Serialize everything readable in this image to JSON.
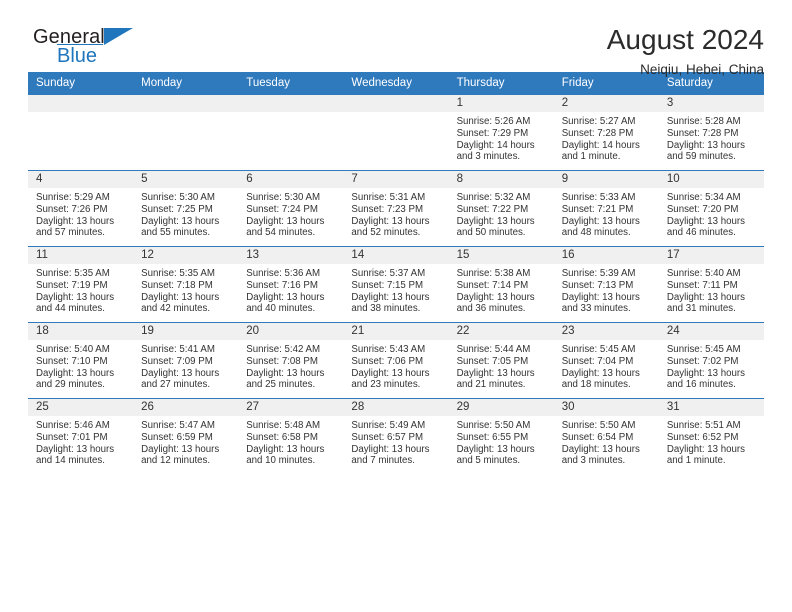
{
  "brand": {
    "name_part1": "General",
    "name_part2": "Blue",
    "logo_icon": "triangle-flag-icon",
    "accent_color": "#1f76bc"
  },
  "header": {
    "title": "August 2024",
    "subtitle": "Neiqiu, Hebei, China"
  },
  "theme": {
    "header_row_bg": "#2f79bd",
    "daynum_band_bg": "#f0f0f0",
    "grid_line": "#2f79bd",
    "text": "#333333"
  },
  "weekday_headers": [
    "Sunday",
    "Monday",
    "Tuesday",
    "Wednesday",
    "Thursday",
    "Friday",
    "Saturday"
  ],
  "labels": {
    "sunrise_prefix": "Sunrise:",
    "sunset_prefix": "Sunset:",
    "daylight_prefix": "Daylight:"
  },
  "weeks": [
    [
      {
        "day": "",
        "blank": true
      },
      {
        "day": "",
        "blank": true
      },
      {
        "day": "",
        "blank": true
      },
      {
        "day": "",
        "blank": true
      },
      {
        "day": "1",
        "sunrise": "Sunrise: 5:26 AM",
        "sunset": "Sunset: 7:29 PM",
        "daylight_line1": "Daylight: 14 hours",
        "daylight_line2": "and 3 minutes."
      },
      {
        "day": "2",
        "sunrise": "Sunrise: 5:27 AM",
        "sunset": "Sunset: 7:28 PM",
        "daylight_line1": "Daylight: 14 hours",
        "daylight_line2": "and 1 minute."
      },
      {
        "day": "3",
        "sunrise": "Sunrise: 5:28 AM",
        "sunset": "Sunset: 7:28 PM",
        "daylight_line1": "Daylight: 13 hours",
        "daylight_line2": "and 59 minutes."
      }
    ],
    [
      {
        "day": "4",
        "sunrise": "Sunrise: 5:29 AM",
        "sunset": "Sunset: 7:26 PM",
        "daylight_line1": "Daylight: 13 hours",
        "daylight_line2": "and 57 minutes."
      },
      {
        "day": "5",
        "sunrise": "Sunrise: 5:30 AM",
        "sunset": "Sunset: 7:25 PM",
        "daylight_line1": "Daylight: 13 hours",
        "daylight_line2": "and 55 minutes."
      },
      {
        "day": "6",
        "sunrise": "Sunrise: 5:30 AM",
        "sunset": "Sunset: 7:24 PM",
        "daylight_line1": "Daylight: 13 hours",
        "daylight_line2": "and 54 minutes."
      },
      {
        "day": "7",
        "sunrise": "Sunrise: 5:31 AM",
        "sunset": "Sunset: 7:23 PM",
        "daylight_line1": "Daylight: 13 hours",
        "daylight_line2": "and 52 minutes."
      },
      {
        "day": "8",
        "sunrise": "Sunrise: 5:32 AM",
        "sunset": "Sunset: 7:22 PM",
        "daylight_line1": "Daylight: 13 hours",
        "daylight_line2": "and 50 minutes."
      },
      {
        "day": "9",
        "sunrise": "Sunrise: 5:33 AM",
        "sunset": "Sunset: 7:21 PM",
        "daylight_line1": "Daylight: 13 hours",
        "daylight_line2": "and 48 minutes."
      },
      {
        "day": "10",
        "sunrise": "Sunrise: 5:34 AM",
        "sunset": "Sunset: 7:20 PM",
        "daylight_line1": "Daylight: 13 hours",
        "daylight_line2": "and 46 minutes."
      }
    ],
    [
      {
        "day": "11",
        "sunrise": "Sunrise: 5:35 AM",
        "sunset": "Sunset: 7:19 PM",
        "daylight_line1": "Daylight: 13 hours",
        "daylight_line2": "and 44 minutes."
      },
      {
        "day": "12",
        "sunrise": "Sunrise: 5:35 AM",
        "sunset": "Sunset: 7:18 PM",
        "daylight_line1": "Daylight: 13 hours",
        "daylight_line2": "and 42 minutes."
      },
      {
        "day": "13",
        "sunrise": "Sunrise: 5:36 AM",
        "sunset": "Sunset: 7:16 PM",
        "daylight_line1": "Daylight: 13 hours",
        "daylight_line2": "and 40 minutes."
      },
      {
        "day": "14",
        "sunrise": "Sunrise: 5:37 AM",
        "sunset": "Sunset: 7:15 PM",
        "daylight_line1": "Daylight: 13 hours",
        "daylight_line2": "and 38 minutes."
      },
      {
        "day": "15",
        "sunrise": "Sunrise: 5:38 AM",
        "sunset": "Sunset: 7:14 PM",
        "daylight_line1": "Daylight: 13 hours",
        "daylight_line2": "and 36 minutes."
      },
      {
        "day": "16",
        "sunrise": "Sunrise: 5:39 AM",
        "sunset": "Sunset: 7:13 PM",
        "daylight_line1": "Daylight: 13 hours",
        "daylight_line2": "and 33 minutes."
      },
      {
        "day": "17",
        "sunrise": "Sunrise: 5:40 AM",
        "sunset": "Sunset: 7:11 PM",
        "daylight_line1": "Daylight: 13 hours",
        "daylight_line2": "and 31 minutes."
      }
    ],
    [
      {
        "day": "18",
        "sunrise": "Sunrise: 5:40 AM",
        "sunset": "Sunset: 7:10 PM",
        "daylight_line1": "Daylight: 13 hours",
        "daylight_line2": "and 29 minutes."
      },
      {
        "day": "19",
        "sunrise": "Sunrise: 5:41 AM",
        "sunset": "Sunset: 7:09 PM",
        "daylight_line1": "Daylight: 13 hours",
        "daylight_line2": "and 27 minutes."
      },
      {
        "day": "20",
        "sunrise": "Sunrise: 5:42 AM",
        "sunset": "Sunset: 7:08 PM",
        "daylight_line1": "Daylight: 13 hours",
        "daylight_line2": "and 25 minutes."
      },
      {
        "day": "21",
        "sunrise": "Sunrise: 5:43 AM",
        "sunset": "Sunset: 7:06 PM",
        "daylight_line1": "Daylight: 13 hours",
        "daylight_line2": "and 23 minutes."
      },
      {
        "day": "22",
        "sunrise": "Sunrise: 5:44 AM",
        "sunset": "Sunset: 7:05 PM",
        "daylight_line1": "Daylight: 13 hours",
        "daylight_line2": "and 21 minutes."
      },
      {
        "day": "23",
        "sunrise": "Sunrise: 5:45 AM",
        "sunset": "Sunset: 7:04 PM",
        "daylight_line1": "Daylight: 13 hours",
        "daylight_line2": "and 18 minutes."
      },
      {
        "day": "24",
        "sunrise": "Sunrise: 5:45 AM",
        "sunset": "Sunset: 7:02 PM",
        "daylight_line1": "Daylight: 13 hours",
        "daylight_line2": "and 16 minutes."
      }
    ],
    [
      {
        "day": "25",
        "sunrise": "Sunrise: 5:46 AM",
        "sunset": "Sunset: 7:01 PM",
        "daylight_line1": "Daylight: 13 hours",
        "daylight_line2": "and 14 minutes."
      },
      {
        "day": "26",
        "sunrise": "Sunrise: 5:47 AM",
        "sunset": "Sunset: 6:59 PM",
        "daylight_line1": "Daylight: 13 hours",
        "daylight_line2": "and 12 minutes."
      },
      {
        "day": "27",
        "sunrise": "Sunrise: 5:48 AM",
        "sunset": "Sunset: 6:58 PM",
        "daylight_line1": "Daylight: 13 hours",
        "daylight_line2": "and 10 minutes."
      },
      {
        "day": "28",
        "sunrise": "Sunrise: 5:49 AM",
        "sunset": "Sunset: 6:57 PM",
        "daylight_line1": "Daylight: 13 hours",
        "daylight_line2": "and 7 minutes."
      },
      {
        "day": "29",
        "sunrise": "Sunrise: 5:50 AM",
        "sunset": "Sunset: 6:55 PM",
        "daylight_line1": "Daylight: 13 hours",
        "daylight_line2": "and 5 minutes."
      },
      {
        "day": "30",
        "sunrise": "Sunrise: 5:50 AM",
        "sunset": "Sunset: 6:54 PM",
        "daylight_line1": "Daylight: 13 hours",
        "daylight_line2": "and 3 minutes."
      },
      {
        "day": "31",
        "sunrise": "Sunrise: 5:51 AM",
        "sunset": "Sunset: 6:52 PM",
        "daylight_line1": "Daylight: 13 hours",
        "daylight_line2": "and 1 minute."
      }
    ]
  ]
}
